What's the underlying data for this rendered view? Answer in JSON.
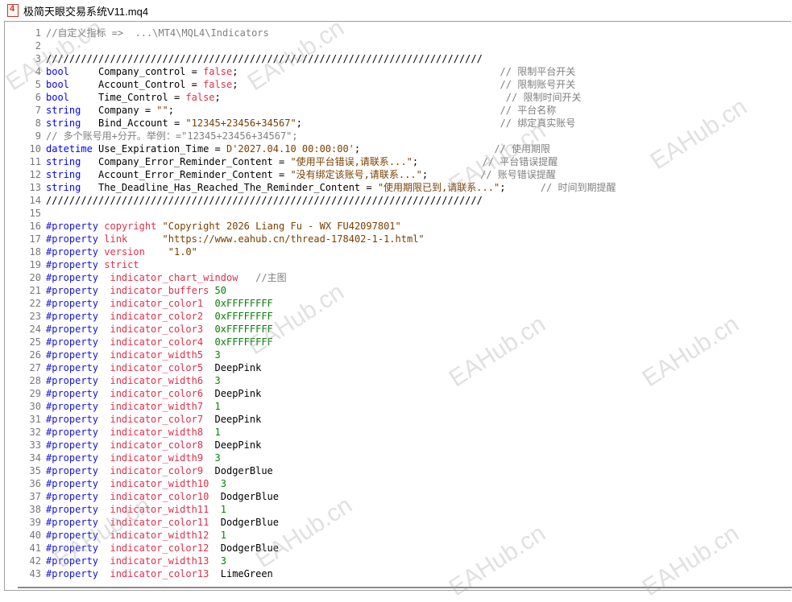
{
  "window": {
    "title": "极简天眼交易系统V11.mq4",
    "icon": "mq4-file-icon"
  },
  "editor": {
    "lines": [
      {
        "n": "1",
        "c": "//自定义指标 =>  ...\\MT4\\MQL4\\Indicators"
      },
      {
        "n": "2",
        "c": ""
      },
      {
        "n": "3",
        "c": "///////////////////////////////////////////////////////////////////////////"
      },
      {
        "n": "4",
        "c": "bool     Company_control = false;                                             // 限制平台开关"
      },
      {
        "n": "5",
        "c": "bool     Account_Control = false;                                             // 限制账号开关"
      },
      {
        "n": "6",
        "c": "bool     Time_Control = false;                                                 // 限制时间开关"
      },
      {
        "n": "7",
        "c": "string   Company = \"\";                                                        // 平台名称"
      },
      {
        "n": "8",
        "c": "string   Bind_Account = \"12345+23456+34567\";                                  // 绑定真实账号"
      },
      {
        "n": "9",
        "c": "// 多个账号用+分开。举例：=\"12345+23456+34567\";"
      },
      {
        "n": "10",
        "c": "datetime Use_Expiration_Time = D'2027.04.10 00:00:00';                       // 使用期限"
      },
      {
        "n": "11",
        "c": "string   Company_Error_Reminder_Content = \"使用平台错误,请联系...\";           // 平台错误提醒"
      },
      {
        "n": "12",
        "c": "string   Account_Error_Reminder_Content = \"没有绑定该账号,请联系...\";         // 账号错误提醒"
      },
      {
        "n": "13",
        "c": "string   The_Deadline_Has_Reached_The_Reminder_Content = \"使用期限已到,请联系...\";      // 时间到期提醒"
      },
      {
        "n": "14",
        "c": "///////////////////////////////////////////////////////////////////////////"
      },
      {
        "n": "15",
        "c": ""
      },
      {
        "n": "16",
        "c": "#property copyright \"Copyright 2026 Liang Fu - WX FU42097801\""
      },
      {
        "n": "17",
        "c": "#property link      \"https://www.eahub.cn/thread-178402-1-1.html\""
      },
      {
        "n": "18",
        "c": "#property version    \"1.0\""
      },
      {
        "n": "19",
        "c": "#property strict"
      },
      {
        "n": "20",
        "c": "#property  indicator_chart_window   //主图"
      },
      {
        "n": "21",
        "c": "#property  indicator_buffers 50"
      },
      {
        "n": "22",
        "c": "#property  indicator_color1  0xFFFFFFFF"
      },
      {
        "n": "23",
        "c": "#property  indicator_color2  0xFFFFFFFF"
      },
      {
        "n": "24",
        "c": "#property  indicator_color3  0xFFFFFFFF"
      },
      {
        "n": "25",
        "c": "#property  indicator_color4  0xFFFFFFFF"
      },
      {
        "n": "26",
        "c": "#property  indicator_width5  3"
      },
      {
        "n": "27",
        "c": "#property  indicator_color5  DeepPink"
      },
      {
        "n": "28",
        "c": "#property  indicator_width6  3"
      },
      {
        "n": "29",
        "c": "#property  indicator_color6  DeepPink"
      },
      {
        "n": "30",
        "c": "#property  indicator_width7  1"
      },
      {
        "n": "31",
        "c": "#property  indicator_color7  DeepPink"
      },
      {
        "n": "32",
        "c": "#property  indicator_width8  1"
      },
      {
        "n": "33",
        "c": "#property  indicator_color8  DeepPink"
      },
      {
        "n": "34",
        "c": "#property  indicator_width9  3"
      },
      {
        "n": "35",
        "c": "#property  indicator_color9  DodgerBlue"
      },
      {
        "n": "36",
        "c": "#property  indicator_width10  3"
      },
      {
        "n": "37",
        "c": "#property  indicator_color10  DodgerBlue"
      },
      {
        "n": "38",
        "c": "#property  indicator_width11  1"
      },
      {
        "n": "39",
        "c": "#property  indicator_color11  DodgerBlue"
      },
      {
        "n": "40",
        "c": "#property  indicator_width12  1"
      },
      {
        "n": "41",
        "c": "#property  indicator_color12  DodgerBlue"
      },
      {
        "n": "42",
        "c": "#property  indicator_width13  3"
      },
      {
        "n": "43",
        "c": "#property  indicator_color13  LimeGreen"
      }
    ]
  },
  "watermark": "EAHub.cn",
  "colors": {
    "keyword": "#0000ff",
    "macro": "#e0304b",
    "string": "#7a3f00",
    "number": "#0a7f0a",
    "comment": "#808080"
  }
}
